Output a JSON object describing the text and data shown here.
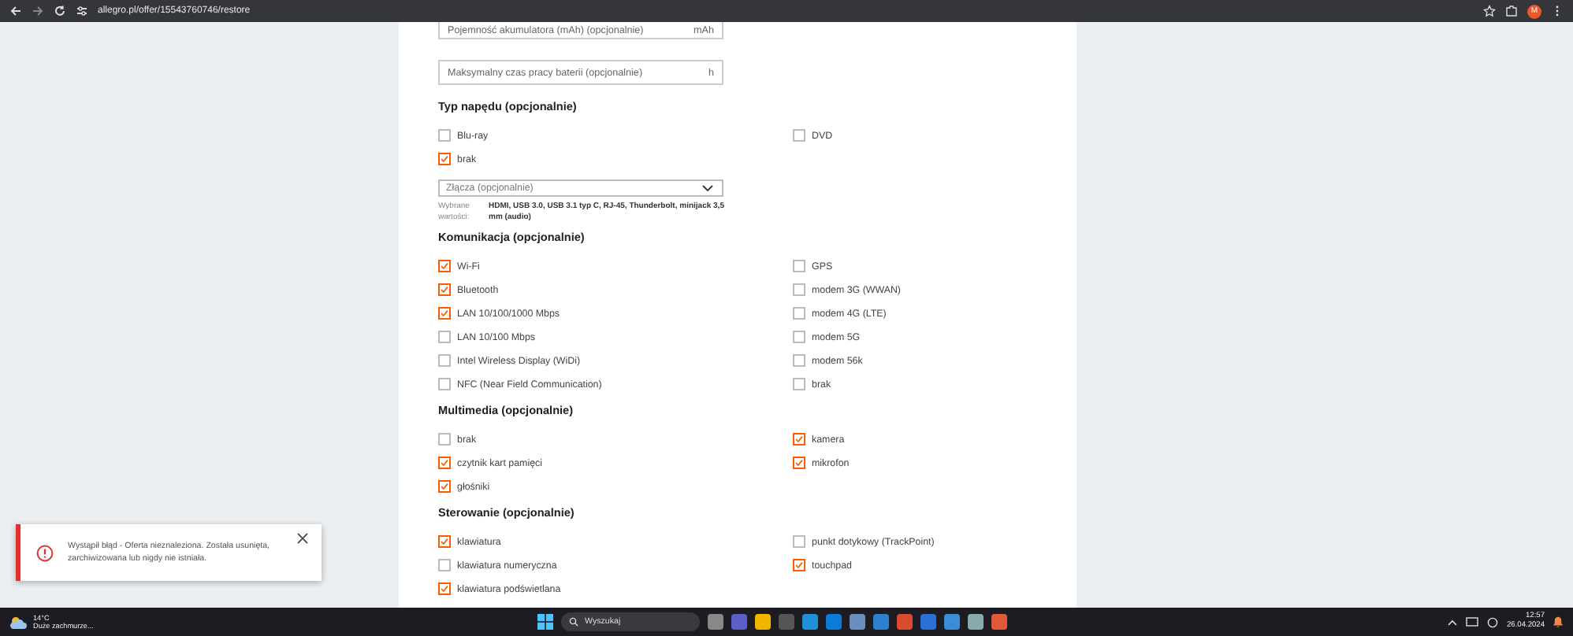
{
  "browser": {
    "url": "allegro.pl/offer/15543760746/restore",
    "profile_initial": "M"
  },
  "form": [
    {
      "kind": "field",
      "placeholder": "Pojemność akumulatora (mAh) (opcjonalnie)",
      "suffix": "mAh"
    },
    {
      "kind": "field",
      "placeholder": "Maksymalny czas pracy baterii (opcjonalnie)",
      "suffix": "h"
    },
    {
      "kind": "group",
      "title": "Typ napędu (opcjonalnie)",
      "options": [
        {
          "label": "Blu-ray",
          "checked": false
        },
        {
          "label": "DVD",
          "checked": false
        },
        {
          "label": "brak",
          "checked": true
        }
      ]
    },
    {
      "kind": "dropdown",
      "placeholder": "Złącza (opcjonalnie)",
      "selected_label": "Wybrane wartości:",
      "selected_values": "HDMI, USB 3.0, USB 3.1 typ C, RJ-45, Thunderbolt, minijack 3,5 mm (audio)"
    },
    {
      "kind": "group",
      "title": "Komunikacja (opcjonalnie)",
      "options": [
        {
          "label": "Wi-Fi",
          "checked": true
        },
        {
          "label": "GPS",
          "checked": false
        },
        {
          "label": "Bluetooth",
          "checked": true
        },
        {
          "label": "modem 3G (WWAN)",
          "checked": false
        },
        {
          "label": "LAN 10/100/1000 Mbps",
          "checked": true
        },
        {
          "label": "modem 4G (LTE)",
          "checked": false
        },
        {
          "label": "LAN 10/100 Mbps",
          "checked": false
        },
        {
          "label": "modem 5G",
          "checked": false
        },
        {
          "label": "Intel Wireless Display (WiDi)",
          "checked": false
        },
        {
          "label": "modem 56k",
          "checked": false
        },
        {
          "label": "NFC (Near Field Communication)",
          "checked": false
        },
        {
          "label": "brak",
          "checked": false
        }
      ]
    },
    {
      "kind": "group",
      "title": "Multimedia (opcjonalnie)",
      "options": [
        {
          "label": "brak",
          "checked": false
        },
        {
          "label": "kamera",
          "checked": true
        },
        {
          "label": "czytnik kart pamięci",
          "checked": true
        },
        {
          "label": "mikrofon",
          "checked": true
        },
        {
          "label": "głośniki",
          "checked": true
        }
      ]
    },
    {
      "kind": "group",
      "title": "Sterowanie (opcjonalnie)",
      "options": [
        {
          "label": "klawiatura",
          "checked": true
        },
        {
          "label": "punkt dotykowy (TrackPoint)",
          "checked": false
        },
        {
          "label": "klawiatura numeryczna",
          "checked": false
        },
        {
          "label": "touchpad",
          "checked": true
        },
        {
          "label": "klawiatura podświetlana",
          "checked": true
        }
      ]
    }
  ],
  "toast": {
    "message": "Wystąpił błąd - Oferta nieznaleziona. Została usunięta, zarchiwizowana lub nigdy nie istniała."
  },
  "taskbar": {
    "temperature": "14°C",
    "weather": "Duże zachmurze...",
    "search_placeholder": "Wyszukaj",
    "time": "12:57",
    "date": "26.04.2024"
  }
}
